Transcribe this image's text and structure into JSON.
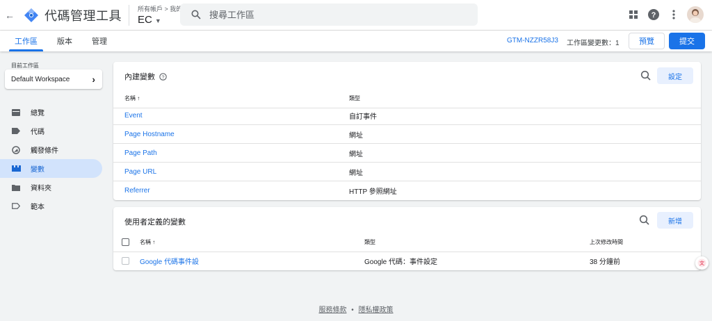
{
  "header": {
    "app_title": "代碼管理工具",
    "account_path": "所有帳戶 > 我的公司",
    "container_name": "EC",
    "search_placeholder": "搜尋工作區"
  },
  "subnav": {
    "tabs": [
      {
        "label": "工作區",
        "active": true
      },
      {
        "label": "版本",
        "active": false
      },
      {
        "label": "管理",
        "active": false
      }
    ],
    "container_id": "GTM-NZZR58J3",
    "workspace_changes": "工作區變更數：1",
    "preview_label": "預覽",
    "submit_label": "提交"
  },
  "sidebar": {
    "workspace_label": "目前工作區",
    "workspace_name": "Default Workspace",
    "items": [
      {
        "label": "總覽",
        "icon": "overview-icon",
        "active": false
      },
      {
        "label": "代碼",
        "icon": "tag-icon",
        "active": false
      },
      {
        "label": "觸發條件",
        "icon": "trigger-icon",
        "active": false
      },
      {
        "label": "變數",
        "icon": "variable-icon",
        "active": true
      },
      {
        "label": "資料夾",
        "icon": "folder-icon",
        "active": false
      },
      {
        "label": "範本",
        "icon": "template-icon",
        "active": false
      }
    ]
  },
  "builtin": {
    "title": "內建變數",
    "configure_label": "設定",
    "col_name": "名稱 ↑",
    "col_type": "類型",
    "rows": [
      {
        "name": "Event",
        "type": "自訂事件"
      },
      {
        "name": "Page Hostname",
        "type": "網址"
      },
      {
        "name": "Page Path",
        "type": "網址"
      },
      {
        "name": "Page URL",
        "type": "網址"
      },
      {
        "name": "Referrer",
        "type": "HTTP 參照網址"
      }
    ]
  },
  "user_defined": {
    "title": "使用者定義的變數",
    "new_label": "新增",
    "col_name": "名稱 ↑",
    "col_type": "類型",
    "col_modified": "上次修改時間",
    "rows": [
      {
        "name": "Google 代碼事件設",
        "type": "Google 代碼：事件設定",
        "modified": "38 分鐘前"
      }
    ]
  },
  "footer": {
    "terms": "服務條款",
    "sep": "•",
    "privacy": "隱私權政策"
  },
  "colors": {
    "accent": "#1a73e8",
    "active_nav_bg": "#d2e3fc",
    "background": "#f1f3f4"
  }
}
